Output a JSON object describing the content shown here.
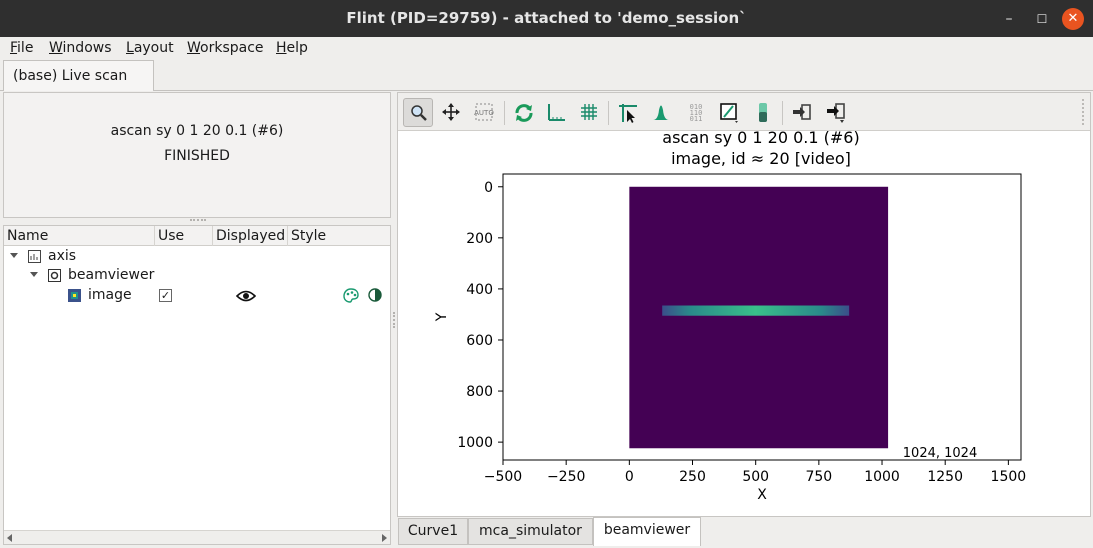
{
  "window": {
    "title": "Flint (PID=29759) - attached to 'demo_session`",
    "minimize": "–",
    "maximize": "☐",
    "close": "✕"
  },
  "menu": [
    "File",
    "Windows",
    "Layout",
    "Workspace",
    "Help"
  ],
  "tabs": {
    "main": "(base) Live scan"
  },
  "status": {
    "scan": "ascan sy 0 1 20 0.1 (#6)",
    "state": "FINISHED"
  },
  "tree": {
    "headers": [
      "Name",
      "Use",
      "Displayed",
      "Style"
    ],
    "items": [
      {
        "label": "axis"
      },
      {
        "label": "beamviewer"
      },
      {
        "label": "image",
        "use": "✓"
      }
    ]
  },
  "plot": {
    "title_line1": "ascan sy 0 1 20 0.1 (#6)",
    "title_line2": "image, id ≈ 20 [video]",
    "xlabel": "X",
    "ylabel": "Y",
    "x_ticks": [
      "−500",
      "−250",
      "0",
      "250",
      "500",
      "750",
      "1000",
      "1250",
      "1500"
    ],
    "y_ticks": [
      "0",
      "200",
      "400",
      "600",
      "800",
      "1000"
    ],
    "coord_readout": "1024, 1024",
    "readout_color": "#e070d8",
    "image_bg_color": "#440154",
    "beam_color": "#29af7f"
  },
  "chart_data": {
    "type": "heatmap",
    "title": "ascan sy 0 1 20 0.1 (#6) / image, id ≈ 20 [video]",
    "xlabel": "X",
    "ylabel": "Y",
    "xlim": [
      -500,
      1550
    ],
    "ylim": [
      1070,
      -50
    ],
    "image_extent": {
      "x": [
        0,
        1024
      ],
      "y": [
        0,
        1024
      ]
    },
    "beam": {
      "x_range": [
        240,
        760
      ],
      "y_center": 485,
      "height": 40
    },
    "colormap": "viridis"
  },
  "bottom_tabs": [
    "Curve1",
    "mca_simulator",
    "beamviewer"
  ],
  "active_bottom_tab": "beamviewer",
  "toolbar": [
    "zoom-icon",
    "pan-icon",
    "auto-scale-icon",
    "refresh-icon",
    "axis-icon",
    "grid-icon",
    "crosshair-icon",
    "profile-icon",
    "data-icon",
    "colormap-icon",
    "colorbar-icon",
    "export-icon",
    "import-icon"
  ]
}
